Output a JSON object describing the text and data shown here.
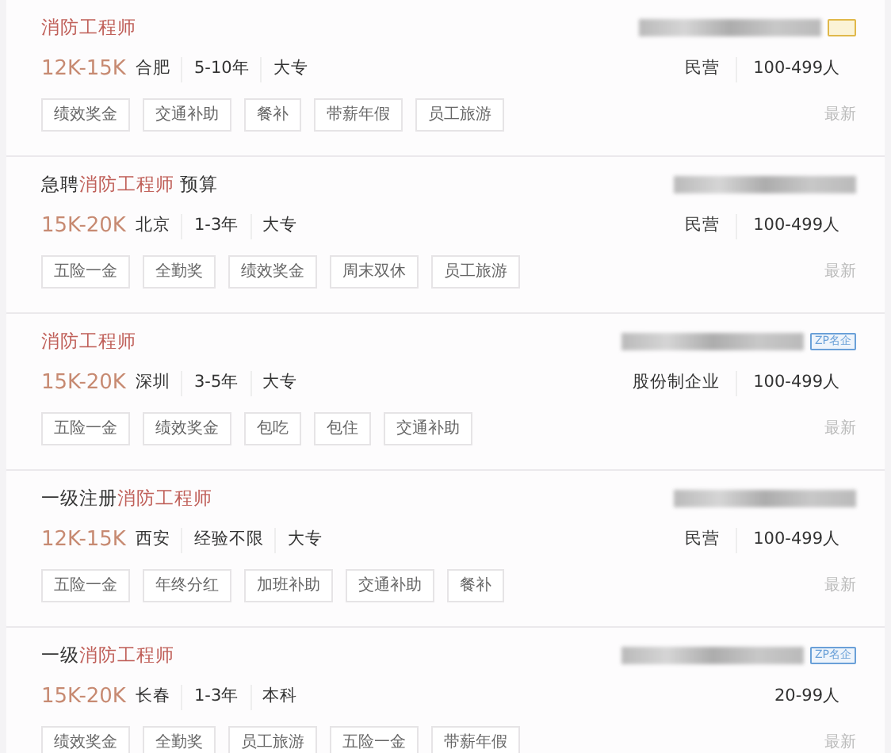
{
  "jobs": [
    {
      "title": [
        {
          "text": "消防工程师",
          "highlight": true
        }
      ],
      "salary": "12K-15K",
      "meta": [
        "合肥",
        "5-10年",
        "大专"
      ],
      "company": {
        "redacted": true,
        "badge": {
          "color": "#e0b84a"
        }
      },
      "info": [
        "民营",
        "100-499人"
      ],
      "tags": [
        "绩效奖金",
        "交通补助",
        "餐补",
        "带薪年假",
        "员工旅游"
      ],
      "status": "最新"
    },
    {
      "title": [
        {
          "text": "急聘",
          "highlight": false
        },
        {
          "text": "消防工程师",
          "highlight": true
        },
        {
          "text": " 预算",
          "highlight": false
        }
      ],
      "salary": "15K-20K",
      "meta": [
        "北京",
        "1-3年",
        "大专"
      ],
      "company": {
        "redacted": true
      },
      "info": [
        "民营",
        "100-499人"
      ],
      "tags": [
        "五险一金",
        "全勤奖",
        "绩效奖金",
        "周末双休",
        "员工旅游"
      ],
      "status": "最新"
    },
    {
      "title": [
        {
          "text": "消防工程师",
          "highlight": true
        }
      ],
      "salary": "15K-20K",
      "meta": [
        "深圳",
        "3-5年",
        "大专"
      ],
      "company": {
        "redacted": true,
        "badge": {
          "text": "ZP名企",
          "color": "#6aa0d8"
        }
      },
      "info": [
        "股份制企业",
        "100-499人"
      ],
      "tags": [
        "五险一金",
        "绩效奖金",
        "包吃",
        "包住",
        "交通补助"
      ],
      "status": "最新"
    },
    {
      "title": [
        {
          "text": "一级注册",
          "highlight": false
        },
        {
          "text": "消防工程师",
          "highlight": true
        }
      ],
      "salary": "12K-15K",
      "meta": [
        "西安",
        "经验不限",
        "大专"
      ],
      "company": {
        "redacted": true
      },
      "info": [
        "民营",
        "100-499人"
      ],
      "tags": [
        "五险一金",
        "年终分红",
        "加班补助",
        "交通补助",
        "餐补"
      ],
      "status": "最新"
    },
    {
      "title": [
        {
          "text": "一级",
          "highlight": false
        },
        {
          "text": "消防工程师",
          "highlight": true
        }
      ],
      "salary": "15K-20K",
      "meta": [
        "长春",
        "1-3年",
        "本科"
      ],
      "company": {
        "redacted": true,
        "badge": {
          "text": "ZP名企",
          "color": "#6aa0d8"
        }
      },
      "info": [
        "20-99人"
      ],
      "tags": [
        "绩效奖金",
        "全勤奖",
        "员工旅游",
        "五险一金",
        "带薪年假"
      ],
      "status": "最新"
    }
  ]
}
